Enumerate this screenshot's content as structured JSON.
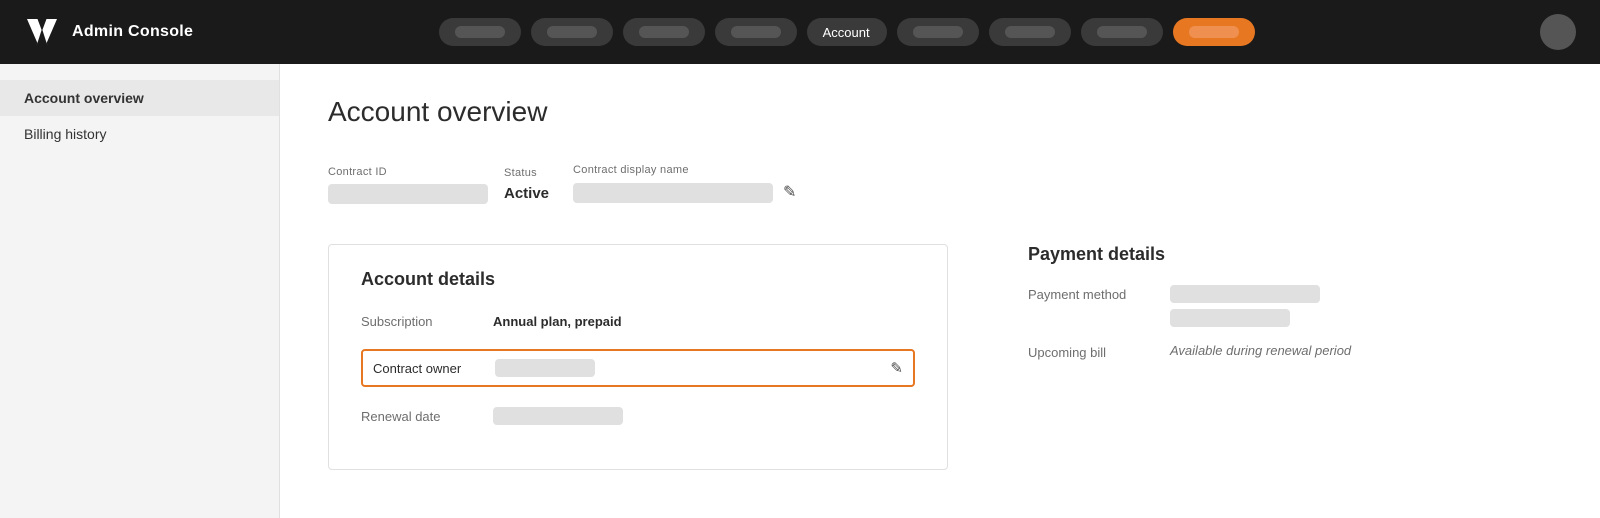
{
  "topnav": {
    "app_name": "Admin Console",
    "nav_pills": [
      {
        "id": "pill1",
        "label": ""
      },
      {
        "id": "pill2",
        "label": ""
      },
      {
        "id": "pill3",
        "label": ""
      },
      {
        "id": "pill4",
        "label": ""
      }
    ],
    "active_nav": "Account",
    "right_pills": [
      {
        "id": "rpill1"
      },
      {
        "id": "rpill2"
      },
      {
        "id": "rpill3"
      },
      {
        "id": "rpill4"
      }
    ],
    "user_pill": {}
  },
  "sidebar": {
    "items": [
      {
        "id": "account-overview",
        "label": "Account overview",
        "active": true
      },
      {
        "id": "billing-history",
        "label": "Billing history",
        "active": false
      }
    ]
  },
  "main": {
    "page_title": "Account overview",
    "contract": {
      "contract_id_label": "Contract ID",
      "status_label": "Status",
      "status_value": "Active",
      "display_name_label": "Contract display name"
    },
    "account_details": {
      "section_title": "Account details",
      "subscription_label": "Subscription",
      "subscription_value": "Annual plan, prepaid",
      "contract_owner_label": "Contract owner",
      "renewal_date_label": "Renewal date"
    },
    "payment_details": {
      "section_title": "Payment details",
      "payment_method_label": "Payment method",
      "upcoming_bill_label": "Upcoming bill",
      "upcoming_bill_value": "Available during renewal period"
    }
  },
  "icons": {
    "edit": "✎",
    "adobe_logo": "A"
  }
}
